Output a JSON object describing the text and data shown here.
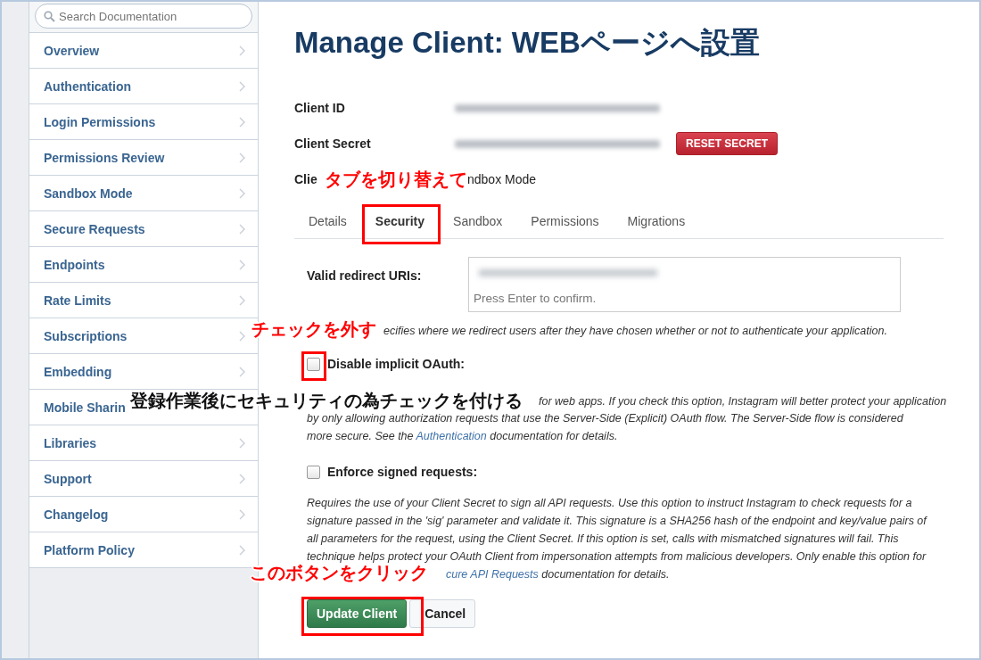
{
  "sidebar": {
    "search": {
      "placeholder": "Search Documentation"
    },
    "items": [
      {
        "label": "Overview",
        "chevron": true
      },
      {
        "label": "Authentication",
        "chevron": true
      },
      {
        "label": "Login Permissions",
        "chevron": true
      },
      {
        "label": "Permissions Review",
        "chevron": true
      },
      {
        "label": "Sandbox Mode",
        "chevron": true
      },
      {
        "label": "Secure Requests",
        "chevron": true
      },
      {
        "label": "Endpoints",
        "chevron": true
      },
      {
        "label": "Rate Limits",
        "chevron": true
      },
      {
        "label": "Subscriptions",
        "chevron": true
      },
      {
        "label": "Embedding",
        "chevron": true
      },
      {
        "label": "Mobile Sharin",
        "chevron": false
      },
      {
        "label": "Libraries",
        "chevron": true
      },
      {
        "label": "Support",
        "chevron": true
      },
      {
        "label": "Changelog",
        "chevron": true
      },
      {
        "label": "Platform Policy",
        "chevron": true
      }
    ]
  },
  "main": {
    "title": "Manage Client: WEBページへ設置",
    "fields": [
      {
        "label": "Client ID",
        "kind": "redacted"
      },
      {
        "label": "Client Secret",
        "kind": "redacted",
        "button": "RESET SECRET"
      },
      {
        "label": "Clie",
        "kind": "text",
        "value": "ndbox Mode"
      }
    ],
    "tabs": [
      {
        "label": "Details",
        "selected": false
      },
      {
        "label": "Security",
        "selected": true
      },
      {
        "label": "Sandbox",
        "selected": false
      },
      {
        "label": "Permissions",
        "selected": false
      },
      {
        "label": "Migrations",
        "selected": false
      }
    ],
    "redirect": {
      "label": "Valid redirect URIs:",
      "placeholder": "Press Enter to confirm.",
      "help": "ecifies where we redirect users after they have chosen whether or not to authenticate your application."
    },
    "options": [
      {
        "label": "Disable implicit OAuth:",
        "checked": false,
        "description": {
          "lead": "for web apps. If you check this option, Instagram will better protect your application",
          "text": "by only allowing authorization requests that use the Server-Side (Explicit) OAuth flow. The Server-Side flow is considered more secure. See the ",
          "link": "Authentication",
          "after": " documentation for details."
        }
      },
      {
        "label": "Enforce signed requests:",
        "checked": false,
        "description": {
          "text": "Requires the use of your Client Secret to sign all API requests. Use this option to instruct Instagram to check requests for a signature passed in the 'sig' parameter and validate it. This signature is a SHA256 hash of the endpoint and key/value pairs of all parameters for the request, using the Client Secret. If this option is set, calls with mismatched signatures will fail. This technique helps protect your OAuth Client from impersonation attempts from malicious developers. Only enable this option for",
          "link": "cure API Requests",
          "after": " documentation for details."
        }
      }
    ],
    "buttons": [
      {
        "label": "Update Client",
        "kind": "primary"
      },
      {
        "label": "Cancel",
        "kind": "default"
      }
    ]
  },
  "annotations": [
    {
      "text": "タブを切り替えて",
      "color": "#ff0000"
    },
    {
      "text": "チェックを外す",
      "color": "#ff0000"
    },
    {
      "text": "登録作業後にセキュリティの為チェックを付ける",
      "color": "#111111"
    },
    {
      "text": "このボタンをクリック",
      "color": "#ff0000"
    }
  ]
}
